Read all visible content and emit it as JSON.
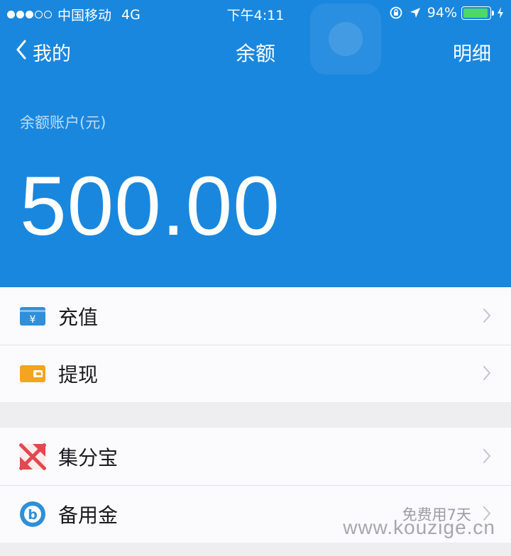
{
  "status_bar": {
    "carrier": "中国移动",
    "network": "4G",
    "time": "下午4:11",
    "battery": "94%",
    "battery_level": 0.94,
    "signal_bars": 3,
    "signal_total": 5
  },
  "nav": {
    "back_label": "我的",
    "title": "余额",
    "detail_label": "明细"
  },
  "balance": {
    "label": "余额账户(元)",
    "amount": "500.00"
  },
  "groups": [
    {
      "items": [
        {
          "label": "充值",
          "icon": "recharge-yuan-card-icon"
        },
        {
          "label": "提现",
          "icon": "withdraw-wallet-icon"
        }
      ]
    },
    {
      "items": [
        {
          "label": "集分宝",
          "icon": "jifenbao-icon"
        },
        {
          "label": "备用金",
          "icon": "beiyongjin-b-icon",
          "extra": "免费用7天"
        }
      ]
    }
  ],
  "watermark": "www.kouzige.cn",
  "colors": {
    "header_bg": "#1a87de",
    "battery_fill": "#4cd964",
    "recharge_icon": "#2f8fd8",
    "withdraw_icon": "#f3a51f",
    "jifenbao_icon": "#e4474e",
    "beiyongjin_icon": "#2f8fd8"
  }
}
